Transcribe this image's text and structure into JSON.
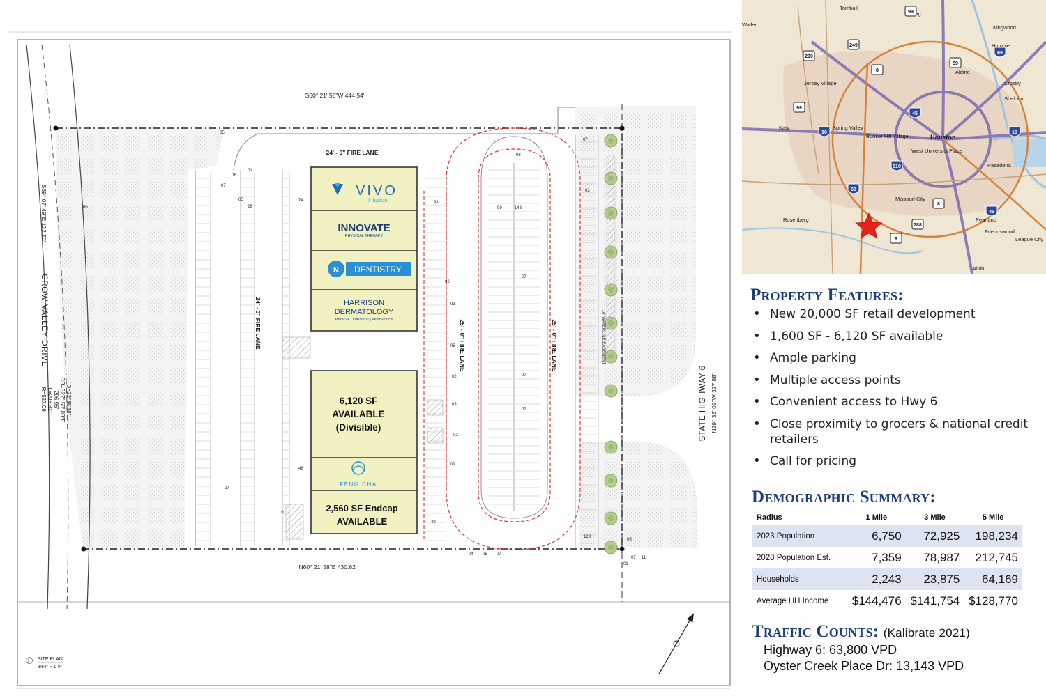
{
  "site_plan": {
    "top_boundary": "S60° 21' 58\"W  444.54'",
    "bottom_boundary": "N60° 21' 58\"E  430.62'",
    "left_boundary": "S39° 07' 49\"E  122.70'",
    "right_boundary": "N29° 38' 02\"W  327.88'",
    "left_road": "CROW VALLEY DRIVE",
    "right_road": "STATE HIGHWAY 6",
    "curve_data": [
      "D=22°38'38\"",
      "CB=S27° 53' 03\"E",
      "206.96'",
      "L=208.31'",
      "R=527.09'"
    ],
    "fire_lane_top": "24' - 0\"  FIRE LANE",
    "fire_lane_left": "24' - 0\"  FIRE LANE",
    "fire_lane_mid": "25' - 0\"  FIRE LANE",
    "fire_lane_right": "25' - 0\"  FIRE LANE",
    "waterline_easement": "10' WATERLINE EASEMENT",
    "site_plan_label": "SITE PLAN",
    "scale": "3/64\" = 1' 0\"",
    "stall_counts": [
      "01",
      "05",
      "07",
      "06",
      "05",
      "28",
      "74",
      "98",
      "99",
      "143",
      "07",
      "02",
      "02",
      "03",
      "05",
      "02",
      "03",
      "02",
      "09",
      "49",
      "48",
      "27",
      "10",
      "123",
      "05",
      "07",
      "04",
      "05",
      "07",
      "11",
      "01",
      "08",
      "07",
      "07",
      "07",
      "06"
    ]
  },
  "tenants": [
    {
      "name": "VIVO",
      "sub": "infusion."
    },
    {
      "name": "INNOVATE",
      "sub": "PHYSICAL THERAPY"
    },
    {
      "name": "DENTISTRY",
      "sub": ""
    },
    {
      "name": "HARRISON",
      "name2": "DERMATOLOGY",
      "sub": "MEDICAL | SURGICAL | AESTHETICS"
    },
    {
      "line1": "6,120 SF",
      "line2": "AVAILABLE",
      "line3": "(Divisible)"
    },
    {
      "name": "FENG CHA"
    },
    {
      "line1": "2,560 SF Endcap",
      "line2": "AVAILABLE"
    }
  ],
  "map": {
    "labels": [
      "Tomball",
      "Spring",
      "Waller",
      "Kingwood",
      "Humble",
      "Aldine",
      "Jersey Village",
      "Crosby",
      "Sheldon",
      "Katy",
      "Spring Valley",
      "Bunker Hill Village",
      "Houston",
      "West University Place",
      "Pasadena",
      "Missouri City",
      "Rosenberg",
      "Pearland",
      "Friendswood",
      "League City",
      "Alvin"
    ],
    "shields": [
      "99",
      "249",
      "290",
      "69",
      "59",
      "8",
      "99",
      "45",
      "10",
      "610",
      "10",
      "69",
      "8",
      "288",
      "45",
      "6"
    ],
    "marker_color": "#e8201e"
  },
  "features": {
    "title": "Property Features:",
    "items": [
      "New 20,000 SF retail development",
      "1,600 SF - 6,120 SF available",
      "Ample parking",
      "Multiple access points",
      "Convenient access to Hwy 6",
      "Close proximity to grocers & national credit retailers",
      "Call for pricing"
    ]
  },
  "demographics": {
    "title": "Demographic Summary:",
    "headers": [
      "Radius",
      "1 Mile",
      "3 Mile",
      "5 Mile"
    ],
    "rows": [
      {
        "label": "2023 Population",
        "values": [
          "6,750",
          "72,925",
          "198,234"
        ]
      },
      {
        "label": "2028 Population Est.",
        "values": [
          "7,359",
          "78,987",
          "212,745"
        ]
      },
      {
        "label": "Households",
        "values": [
          "2,243",
          "23,875",
          "64,169"
        ]
      },
      {
        "label": "Average HH Income",
        "values": [
          "$144,476",
          "$141,754",
          "$128,770"
        ]
      }
    ]
  },
  "traffic": {
    "title": "Traffic Counts:",
    "source": "(Kalibrate 2021)",
    "lines": [
      "Highway 6: 63,800 VPD",
      "Oyster Creek Place Dr: 13,143 VPD"
    ]
  },
  "colors": {
    "heading_blue": "#1f3d7a",
    "tenant_fill": "#f2f1c2",
    "fire_lane": "#e03030",
    "table_shade": "#dde3f0"
  }
}
